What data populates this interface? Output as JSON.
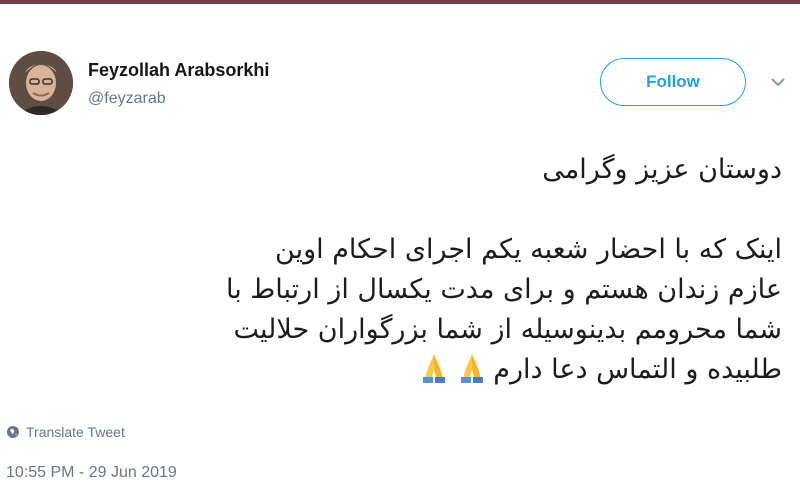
{
  "colors": {
    "accent": "#1da1f2",
    "secondary_text": "#657786",
    "top_bar": "#7b3a47"
  },
  "author": {
    "display_name": "Feyzollah Arabsorkhi",
    "handle": "@feyzarab",
    "avatar_icon": "profile-photo"
  },
  "actions": {
    "follow_label": "Follow",
    "menu_icon": "chevron-down-icon"
  },
  "tweet": {
    "greeting": "دوستان عزیز وگرامی",
    "lines": [
      "اینک که با احضار  شعبه یکم اجرای احکام اوین",
      "عازم زندان هستم و برای مدت یکسال از ارتباط با",
      "شما محرومم بدینوسیله از شما بزرگواران حلالیت",
      "طلبیده و التماس دعا دارم"
    ],
    "emoji": "folded-hands-icon"
  },
  "footer": {
    "translate_label": "Translate Tweet",
    "translate_icon": "globe-icon",
    "timestamp": "10:55 PM - 29 Jun 2019"
  }
}
